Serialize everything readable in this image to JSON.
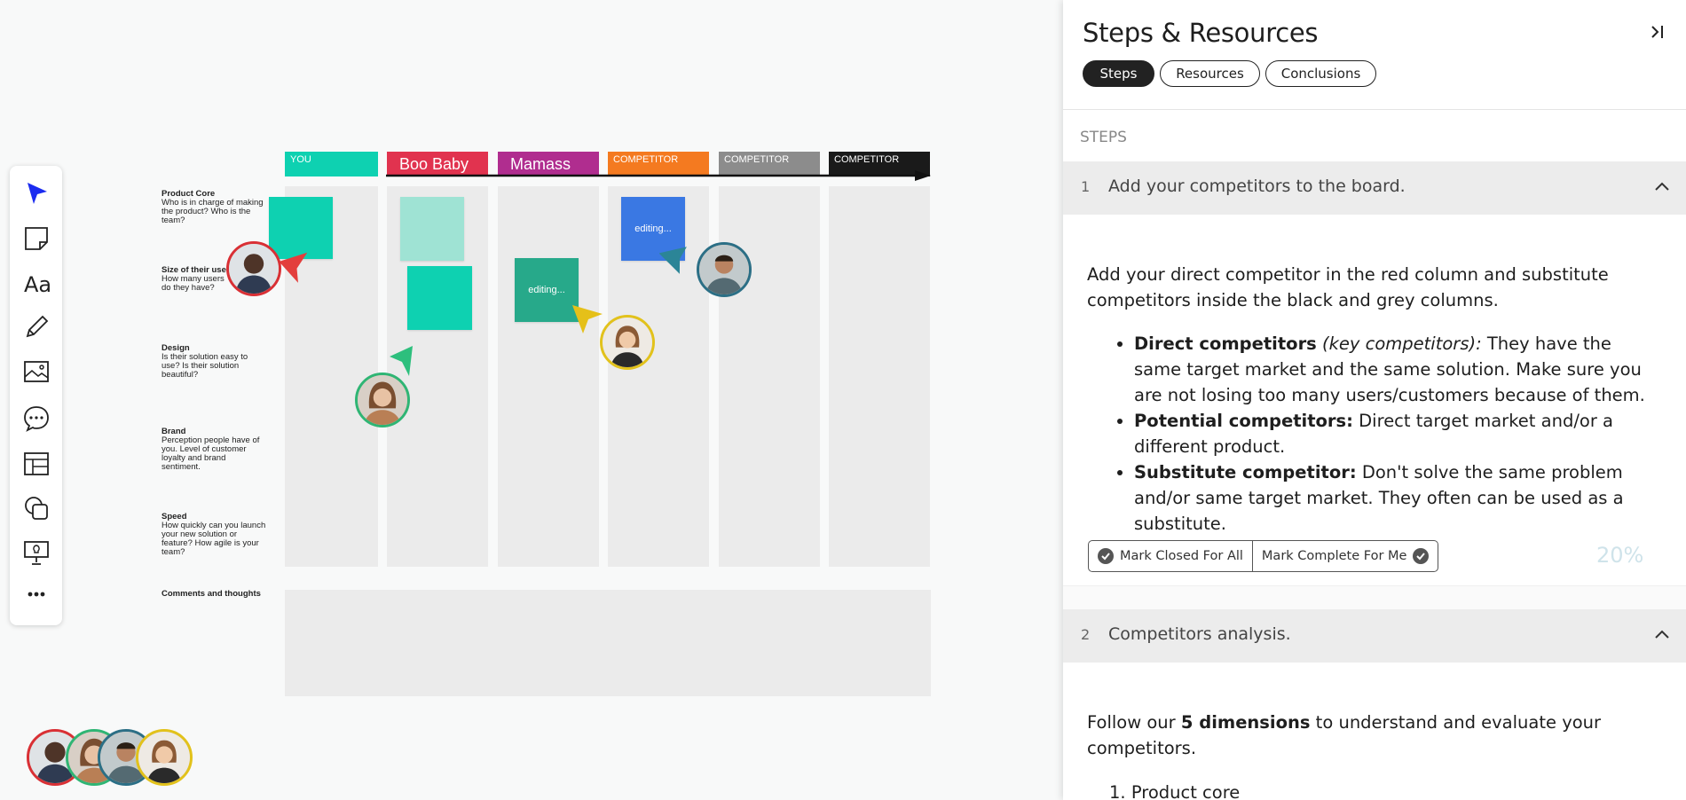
{
  "board": {
    "columns": [
      {
        "label": "YOU",
        "color": "#0ed1b1",
        "style": "small"
      },
      {
        "label": "Boo Baby",
        "color": "#e1334f",
        "style": "big"
      },
      {
        "label": "Mamass",
        "color": "#b02d8f",
        "style": "big"
      },
      {
        "label": "COMPETITOR",
        "color": "#f47a20",
        "style": "small"
      },
      {
        "label": "COMPETITOR",
        "color": "#8c8c8c",
        "style": "small"
      },
      {
        "label": "COMPETITOR",
        "color": "#1a1a1a",
        "style": "small"
      }
    ],
    "rows": [
      {
        "title": "Product Core",
        "desc": "Who is in charge of making the product? Who is the team?"
      },
      {
        "title": "Size of their user",
        "desc": "How many users do they have?"
      },
      {
        "title": "Design",
        "desc": "Is their solution easy to use? Is their solution beautiful?"
      },
      {
        "title": "Brand",
        "desc": "Perception people have of you. Level of customer loyalty and brand sentiment."
      },
      {
        "title": "Speed",
        "desc": "How quickly can you launch your new solution or feature? How agile is your team?"
      },
      {
        "title": "Comments and thoughts",
        "desc": ""
      }
    ],
    "editing_label": "editing..."
  },
  "toolbar": {
    "tools": [
      "select-icon",
      "sticky-note-icon",
      "text-icon",
      "pen-icon",
      "image-icon",
      "comment-icon",
      "template-icon",
      "shapes-icon",
      "presentation-icon",
      "more-icon"
    ]
  },
  "collaborators": [
    "#d93035",
    "#2fb574",
    "#2b6f86",
    "#e2c21b"
  ],
  "panel": {
    "title": "Steps & Resources",
    "tabs": [
      "Steps",
      "Resources",
      "Conclusions"
    ],
    "active_tab": "Steps",
    "steps_heading": "STEPS",
    "steps": [
      {
        "num": "1",
        "title": "Add your competitors to the board.",
        "intro": "Add your direct competitor in the red column and substitute competitors inside the black and grey columns.",
        "bullets": [
          {
            "bold": "Direct competitors",
            "italic": "(key competitors):",
            "text": " They have the same target market and the same solution. Make sure you are not losing too many users/customers because of them."
          },
          {
            "bold": "Potential competitors:",
            "italic": "",
            "text": " Direct target market and/or a different product."
          },
          {
            "bold": "Substitute competitor:",
            "italic": "",
            "text": " Don't solve the same problem and/or same target market. They often can be used as a substitute."
          }
        ],
        "mark_closed_label": "Mark Closed For All",
        "mark_complete_label": "Mark Complete For Me",
        "progress": "20%"
      },
      {
        "num": "2",
        "title": "Competitors analysis.",
        "intro_pre": "Follow our ",
        "intro_bold": "5 dimensions",
        "intro_post": " to understand and evaluate your competitors.",
        "list_first": "Product core"
      }
    ]
  }
}
